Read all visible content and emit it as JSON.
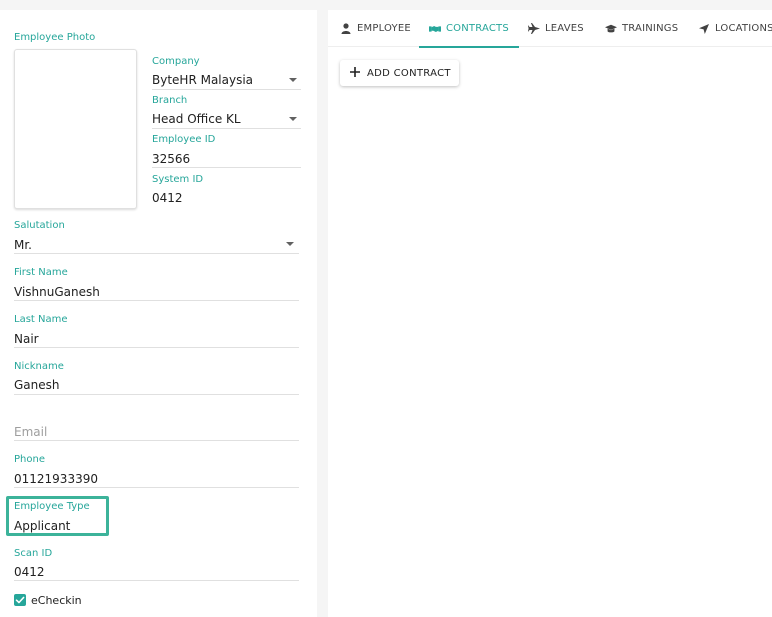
{
  "form": {
    "photo_label": "Employee Photo",
    "company_label": "Company",
    "company_value": "ByteHR Malaysia",
    "branch_label": "Branch",
    "branch_value": "Head Office KL",
    "employee_id_label": "Employee ID",
    "employee_id_value": "32566",
    "system_id_label": "System ID",
    "system_id_value": "0412",
    "salutation_label": "Salutation",
    "salutation_value": "Mr.",
    "first_name_label": "First Name",
    "first_name_value": "VishnuGanesh",
    "last_name_label": "Last Name",
    "last_name_value": "Nair",
    "nickname_label": "Nickname",
    "nickname_value": "Ganesh",
    "email_placeholder": "Email",
    "phone_label": "Phone",
    "phone_value": "01121933390",
    "employee_type_label": "Employee Type",
    "employee_type_value": "Applicant",
    "scan_id_label": "Scan ID",
    "scan_id_value": "0412",
    "echeckin_label": "eCheckin",
    "echeckin_checked": true
  },
  "tabs": [
    {
      "label": "EMPLOYEE",
      "icon": "person-icon",
      "active": false
    },
    {
      "label": "CONTRACTS",
      "icon": "handshake-icon",
      "active": true
    },
    {
      "label": "LEAVES",
      "icon": "airplane-icon",
      "active": false
    },
    {
      "label": "TRAININGS",
      "icon": "graduation-cap-icon",
      "active": false
    },
    {
      "label": "LOCATIONS",
      "icon": "location-arrow-icon",
      "active": false
    }
  ],
  "actions": {
    "add_contract_label": "ADD CONTRACT",
    "add_icon": "plus-icon"
  },
  "colors": {
    "accent": "#26a69a",
    "highlight_border": "#3cb39a",
    "text": "#212121"
  }
}
